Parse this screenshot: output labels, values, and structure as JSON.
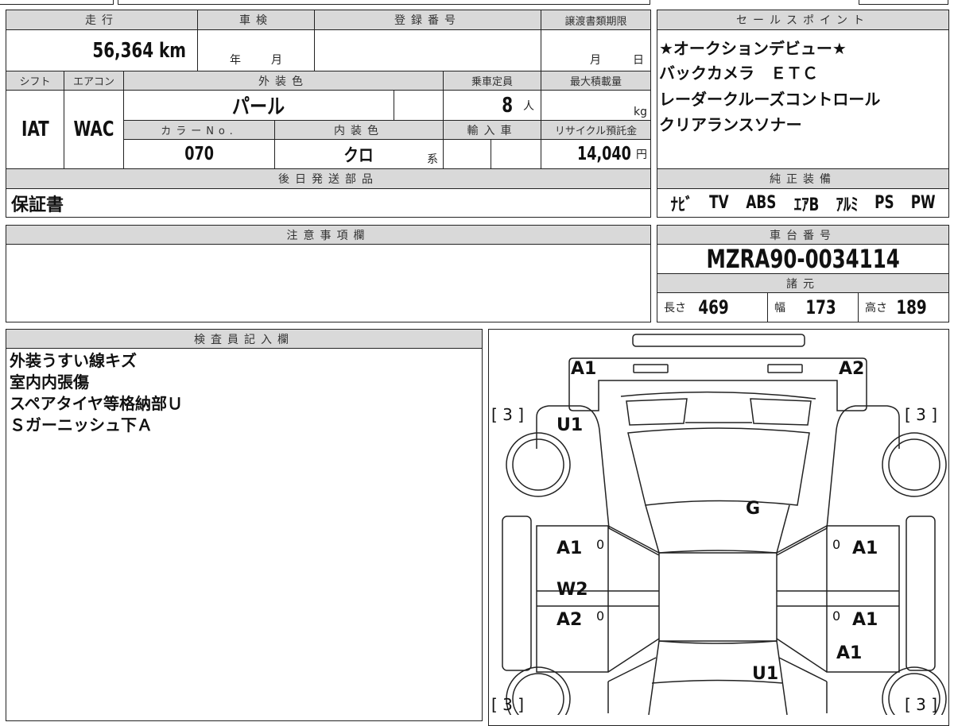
{
  "vehicle": {
    "mileage_h": "走行",
    "mileage": "56,364 km",
    "inspection_h": "車検",
    "inspection_year": "年",
    "inspection_month": "月",
    "registration_h": "登録番号",
    "transfer_h": "譲渡書類期限",
    "transfer_month": "月",
    "transfer_day": "日",
    "shift_h": "シフト",
    "shift": "IAT",
    "ac_h": "エアコン",
    "ac": "WAC",
    "ext_color_h": "外装色",
    "ext_color": "パール",
    "capacity_h": "乗車定員",
    "capacity": "8",
    "capacity_unit": "人",
    "max_load_h": "最大積載量",
    "max_load_unit": "kg",
    "color_no_h": "カラーNo.",
    "color_no": "070",
    "int_color_h": "内装色",
    "int_color": "クロ",
    "int_color_unit": "系",
    "import_h": "輸入車",
    "recycle_h": "リサイクル預託金",
    "recycle": "14,040",
    "recycle_unit": "円",
    "later_parts_h": "後日発送部品",
    "later_parts": "保証書"
  },
  "sales_points": {
    "header": "セールスポイント",
    "lines": [
      "★オークションデビュー★",
      "バックカメラ　ＥＴＣ",
      "レーダークルーズコントロール",
      "クリアランスソナー"
    ]
  },
  "equipment": {
    "header": "純正装備",
    "items": [
      "ﾅﾋﾞ",
      "TV",
      "ABS",
      "ｴｱB",
      "ｱﾙﾐ",
      "PS",
      "PW"
    ]
  },
  "notes": {
    "header": "注意事項欄"
  },
  "chassis": {
    "header": "車台番号",
    "value": "MZRA90-0034114"
  },
  "specs": {
    "header": "諸元",
    "length_l": "長さ",
    "length": "469",
    "width_l": "幅",
    "width": "173",
    "height_l": "高さ",
    "height": "189"
  },
  "inspector": {
    "header": "検査員記入欄",
    "lines": [
      "外装うすい線キズ",
      "室内内張傷",
      "スペアタイヤ等格納部Ｕ",
      "Ｓガーニッシュ下Ａ"
    ]
  },
  "diagram": {
    "marks": {
      "front_left": "A1",
      "front_right": "A2",
      "fl_fender": "U1",
      "hood": "G",
      "lf_door": "A1",
      "lf_door_mark": "0",
      "lr_door_w": "W2",
      "lr_door": "A2",
      "lr_door_mark": "0",
      "rf_door_mark": "0",
      "rf_door": "A1",
      "rr_door_mark": "0",
      "rr_door": "A1",
      "rr_fender": "A1",
      "rear": "U1"
    },
    "tire_fl": "[ 3 ]",
    "tire_fr": "[ 3 ]",
    "tire_rl": "[ 3 ]",
    "tire_rr": "[ 3 ]"
  }
}
